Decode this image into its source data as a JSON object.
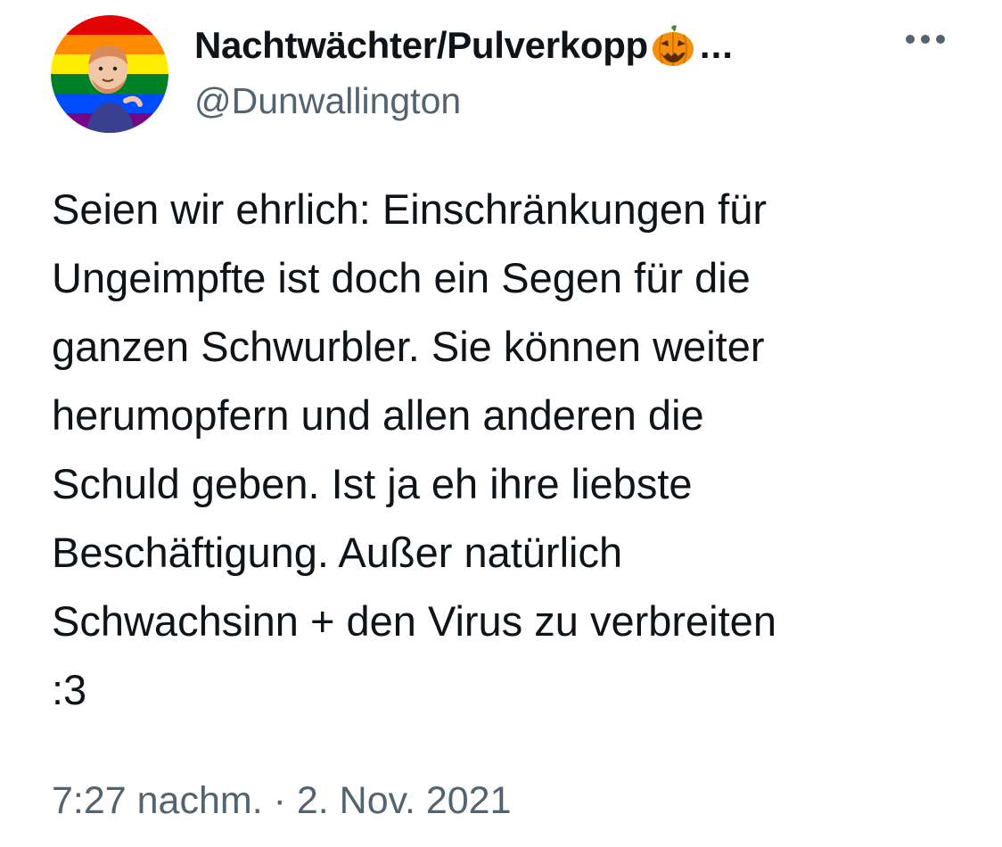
{
  "author": {
    "display_name": "Nachtwächter/Pulverkopp",
    "name_emoji": "jack-o-lantern-icon",
    "truncation": "...",
    "handle": "@Dunwallington",
    "avatar": "pride-flag-avatar"
  },
  "more_icon": "more-horizontal-icon",
  "tweet": {
    "text": "Seien wir ehrlich: Einschränkungen für\nUngeimpfte ist doch ein Segen für die\nganzen Schwurbler. Sie können weiter\nherumopfern und allen anderen die\nSchuld geben. Ist ja eh ihre liebste\nBeschäftigung. Außer natürlich\nSchwachsinn + den Virus zu verbreiten\n:3",
    "time": "7:27 nachm.",
    "separator": " · ",
    "date": "2. Nov. 2021"
  },
  "colors": {
    "text": "#0f1419",
    "secondary": "#536471",
    "pride_red": "#e40303",
    "pride_orange": "#ff8c00",
    "pride_yellow": "#ffed00",
    "pride_green": "#008026",
    "pride_blue": "#004dff",
    "pride_purple": "#750787"
  }
}
